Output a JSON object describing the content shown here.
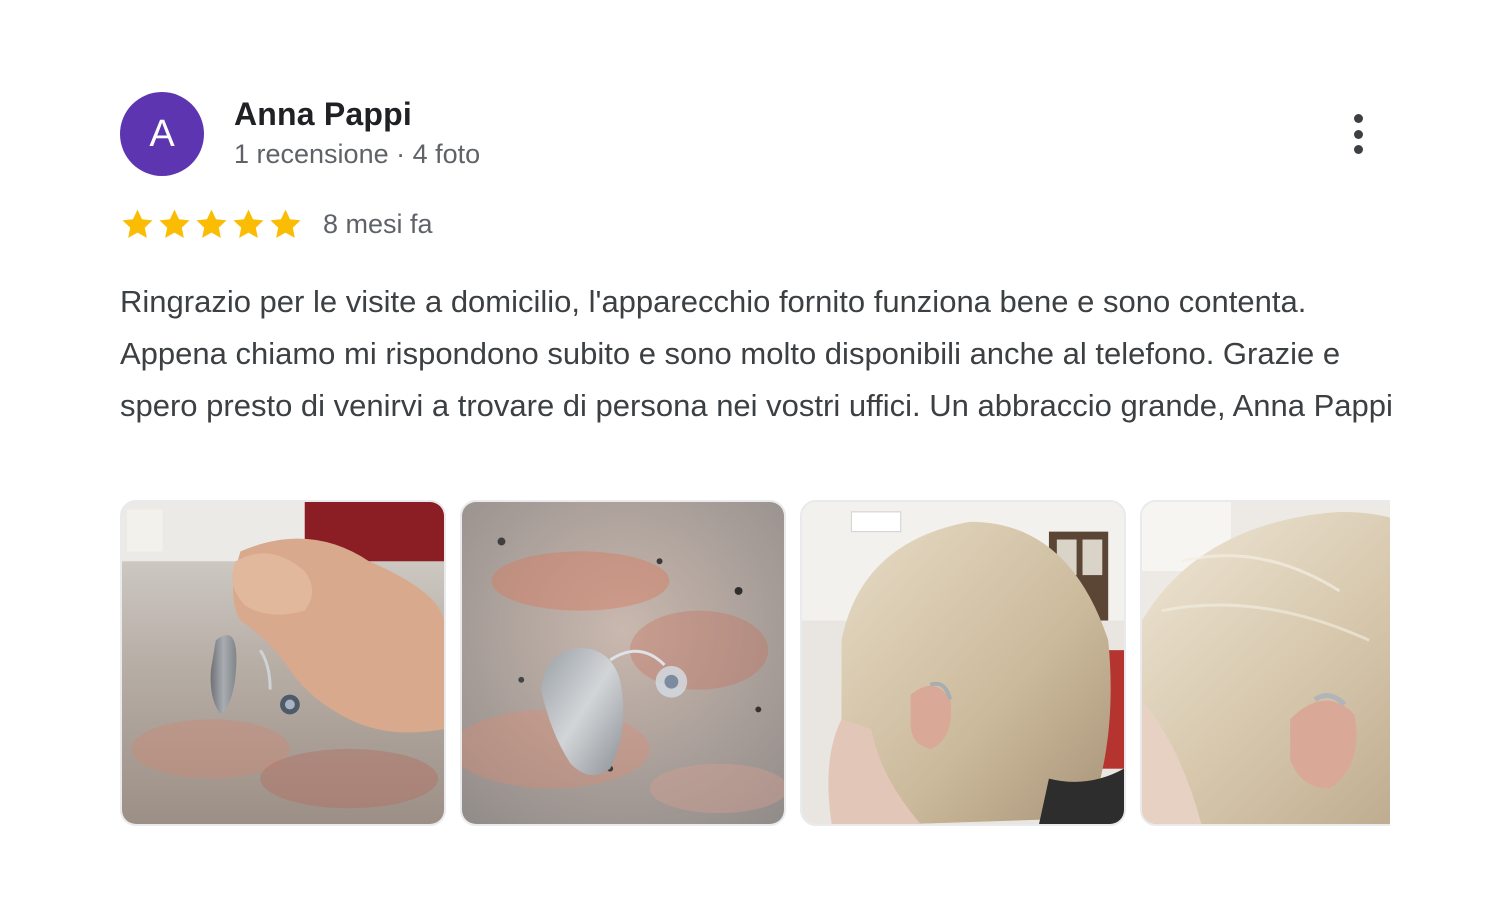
{
  "review": {
    "author": {
      "initial": "A",
      "name": "Anna Pappi",
      "meta": "1 recensione · 4 foto",
      "avatar_color": "#5e35b1"
    },
    "rating": 5,
    "rating_max": 5,
    "star_color": "#fbbc04",
    "time": "8 mesi fa",
    "text": "Ringrazio per le visite a domicilio, l'apparecchio fornito funziona bene e sono contenta. Appena chiamo mi rispondono subito e sono molto disponibili anche al telefono. Grazie e spero presto di venirvi a trovare di persona nei vostri uffici. Un abbraccio grande, Anna Pappi",
    "menu_icon": "more-vert-icon",
    "photos": [
      {
        "depicts": "hand holding hearing aid"
      },
      {
        "depicts": "hearing aid on granite"
      },
      {
        "depicts": "hearing aid worn behind ear"
      },
      {
        "depicts": "hearing aid behind ear close-up"
      }
    ]
  }
}
